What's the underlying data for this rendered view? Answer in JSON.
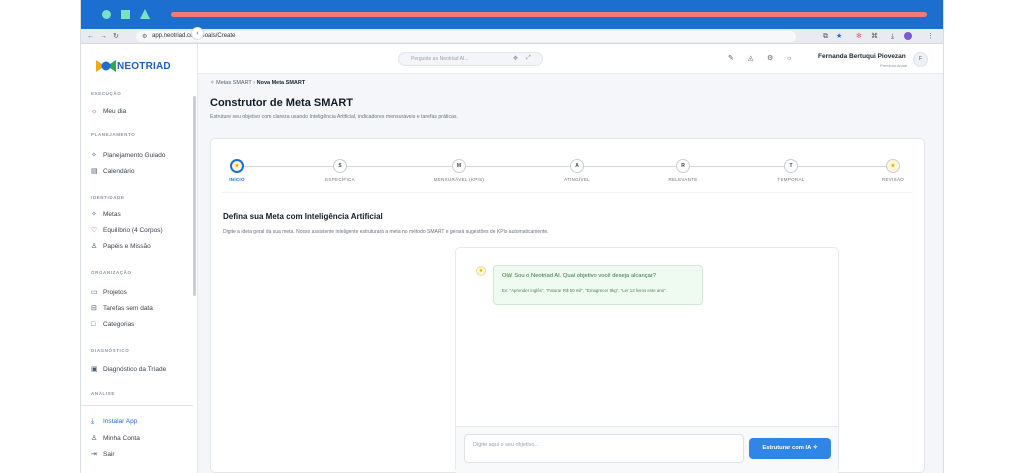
{
  "browser": {
    "url": "app.neotriad.com/Goals/Create"
  },
  "brand": {
    "logo_text": "NEOTRIAD",
    "color_primary": "#1d6fcf",
    "color_accent": "#e0a800"
  },
  "header": {
    "ask_placeholder": "Pergunte ao Neotriad AI...",
    "user_name": "Fernanda Bertuqui Piovezan",
    "user_plan": "Premium Anual",
    "avatar_initial": "F"
  },
  "sidebar": {
    "sections": [
      {
        "title": "EXECUÇÃO",
        "items": [
          {
            "label": "Meu dia",
            "icon": "sun-icon"
          }
        ]
      },
      {
        "title": "PLANEJAMENTO",
        "items": [
          {
            "label": "Planejamento Guiado",
            "icon": "sparkle-icon"
          },
          {
            "label": "Calendário",
            "icon": "calendar-icon"
          }
        ]
      },
      {
        "title": "IDENTIDADE",
        "items": [
          {
            "label": "Metas",
            "icon": "sparkle-icon"
          },
          {
            "label": "Equilíbrio (4 Corpos)",
            "icon": "heart-icon"
          },
          {
            "label": "Papéis e Missão",
            "icon": "people-icon"
          }
        ]
      },
      {
        "title": "ORGANIZAÇÃO",
        "items": [
          {
            "label": "Projetos",
            "icon": "folder-icon"
          },
          {
            "label": "Tarefas sem data",
            "icon": "inbox-icon"
          },
          {
            "label": "Categorias",
            "icon": "square-icon"
          }
        ]
      },
      {
        "title": "DIAGNÓSTICO",
        "items": [
          {
            "label": "Diagnóstico da Tríade",
            "icon": "clipboard-icon"
          }
        ]
      },
      {
        "title": "ANÁLISE",
        "items": []
      }
    ],
    "footer": [
      {
        "label": "Instalar App",
        "icon": "download-icon"
      },
      {
        "label": "Minha Conta",
        "icon": "user-icon"
      },
      {
        "label": "Sair",
        "icon": "logout-icon"
      }
    ]
  },
  "main": {
    "breadcrumb": {
      "parent": "Metas SMART",
      "separator": "›",
      "current": "Nova Meta SMART"
    },
    "title": "Construtor de Meta SMART",
    "subtitle": "Estruture seu objetivo com clareza usando Inteligência Artificial, indicadores mensuráveis e tarefas práticas.",
    "steps": [
      {
        "glyph": "★",
        "label": "INÍCIO",
        "state": "active"
      },
      {
        "glyph": "S",
        "label": "ESPECÍFICA",
        "state": "pending"
      },
      {
        "glyph": "M",
        "label": "MENSURÁVEL (KPIS)",
        "state": "pending"
      },
      {
        "glyph": "A",
        "label": "ATINGÍVEL",
        "state": "pending"
      },
      {
        "glyph": "R",
        "label": "RELEVANTE",
        "state": "pending"
      },
      {
        "glyph": "T",
        "label": "TEMPORAL",
        "state": "pending"
      },
      {
        "glyph": "★",
        "label": "REVISÃO",
        "state": "pending"
      }
    ],
    "section_title": "Defina sua Meta com Inteligência Artificial",
    "section_desc": "Digite a ideia geral da sua meta. Nosso assistente inteligente estruturará a meta no método SMART e gerará sugestões de KPIs automaticamente.",
    "chat": {
      "bot_message": "Olá! Sou o Neotriad AI. Qual objetivo você deseja alcançar?",
      "examples": "Ex: \"Aprender inglês\", \"Faturar R$ 50 mil\", \"Emagrecer 8kg\", \"Ler 12 livros este ano\".",
      "input_placeholder": "Digite aqui o seu objetivo...",
      "submit_label": "Estruturar com IA"
    }
  }
}
